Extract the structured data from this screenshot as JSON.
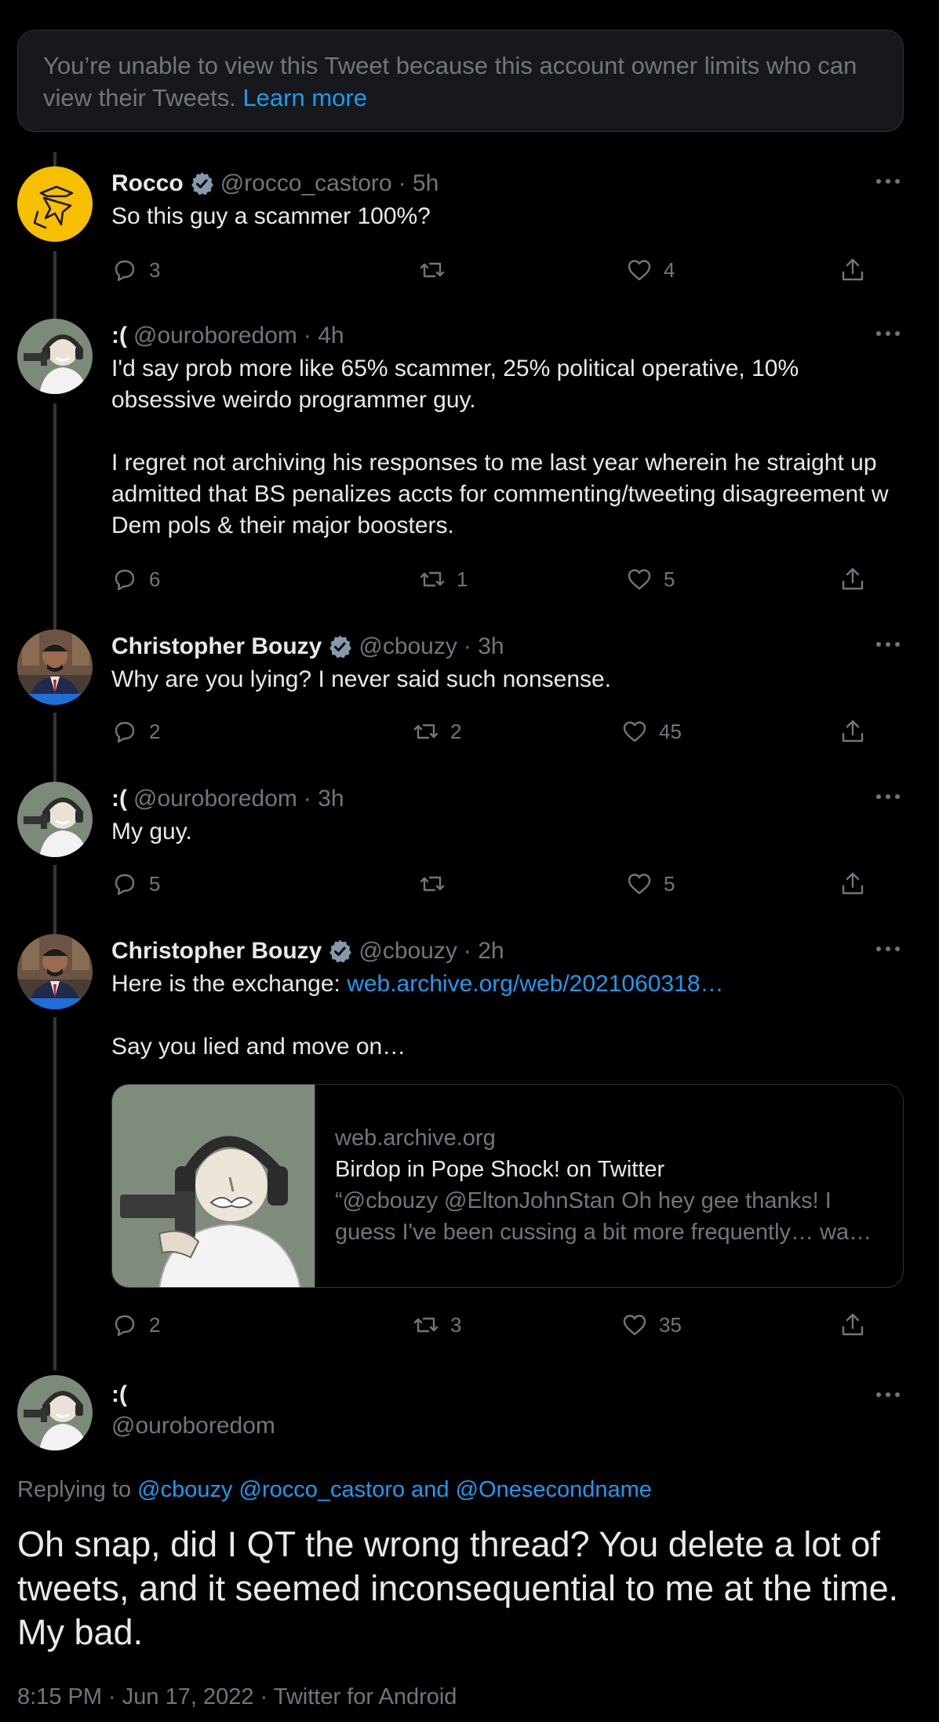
{
  "notice": {
    "text": "You’re unable to view this Tweet because this account owner limits who can view their Tweets.",
    "link": "Learn more"
  },
  "tweets": [
    {
      "name": "Rocco",
      "verified": true,
      "handle": "@rocco_castoro",
      "time": "· 5h",
      "text": "So this guy a scammer 100%?",
      "replies": "3",
      "retweets": "",
      "likes": "4",
      "avatar": "rocco-avatar"
    },
    {
      "name": ":(",
      "verified": false,
      "handle": "@ouroboredom",
      "time": "· 4h",
      "text": "I'd say prob more like 65% scammer, 25% political operative, 10% obsessive weirdo programmer guy.\n\nI regret not archiving his responses to me last year wherein he straight up admitted that BS penalizes accts for commenting/tweeting disagreement w Dem pols & their major boosters.",
      "replies": "6",
      "retweets": "1",
      "likes": "5",
      "avatar": "ouroboredom-avatar"
    },
    {
      "name": "Christopher Bouzy",
      "verified": true,
      "handle": "@cbouzy",
      "time": "· 3h",
      "text": "Why are you lying? I never said such nonsense.",
      "replies": "2",
      "retweets": "2",
      "likes": "45",
      "avatar": "cbouzy-avatar"
    },
    {
      "name": ":(",
      "verified": false,
      "handle": "@ouroboredom",
      "time": "· 3h",
      "text": "My guy.",
      "replies": "5",
      "retweets": "",
      "likes": "5",
      "avatar": "ouroboredom-avatar"
    },
    {
      "name": "Christopher Bouzy",
      "verified": true,
      "handle": "@cbouzy",
      "time": "· 2h",
      "text_before": "Here is the exchange: ",
      "text_link": "web.archive.org/web/2021060318…",
      "text_after": "\n\nSay you lied and move on…",
      "card": {
        "domain": "web.archive.org",
        "title": "Birdop in Pope Shock! on Twitter",
        "description": "“@cbouzy @EltonJohnStan Oh hey gee thanks! I guess I've been cussing a bit more frequently… wa…"
      },
      "replies": "2",
      "retweets": "3",
      "likes": "35",
      "avatar": "cbouzy-avatar"
    }
  ],
  "main": {
    "name": ":(",
    "handle": "@ouroboredom",
    "replying_label": "Replying to",
    "mentions": "@cbouzy @rocco_castoro and @Onesecondname",
    "text": "Oh snap, did I QT the wrong thread? You delete a lot of tweets, and it seemed inconsequential to me at the time. My bad.",
    "meta": "8:15 PM · Jun 17, 2022 · Twitter for Android"
  },
  "colors": {
    "background": "#000000",
    "link": "#1d9bf0",
    "muted": "#71767b",
    "verified": "#829aab"
  }
}
